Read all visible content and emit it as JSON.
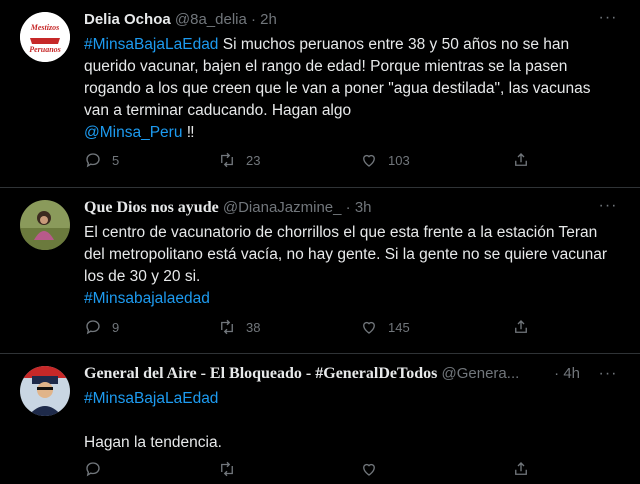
{
  "tweets": [
    {
      "name": "Delia Ochoa",
      "handle": "@8a_delia",
      "dot": "·",
      "time": "2h",
      "more": "···",
      "hashtag": "#MinsaBajaLaEdad",
      "text": " Si muchos peruanos entre 38 y 50 años no se han querido vacunar, bajen el rango de edad! Porque mientras se la pasen rogando a los que creen que le van a poner \"agua destilada\", las vacunas van a terminar caducando.  Hagan algo",
      "mention": "@Minsa_Peru",
      "after_mention": " ‼",
      "replies": "5",
      "retweets": "23",
      "likes": "103",
      "avatar_text": "Mestizos Peruanos"
    },
    {
      "name": "Que Dios nos ayude",
      "handle": "@DianaJazmine_",
      "dot": "·",
      "time": "3h",
      "more": "···",
      "text": "El centro de vacunatorio de chorrillos el que esta frente a la estación Teran del metropolitano está vacía, no hay gente. Si la gente no se quiere vacunar los de 30 y 20 si.",
      "hashtag": "#Minsabajalaedad",
      "replies": "9",
      "retweets": "38",
      "likes": "145"
    },
    {
      "name": "General del Aire - El Bloqueado - #GeneralDeTodos",
      "handle": "@Genera...",
      "dot": "·",
      "time": "4h",
      "hashtag": "#MinsaBajaLaEdad",
      "text": "Hagan la tendencia."
    }
  ],
  "icons": [
    "reply-icon",
    "retweet-icon",
    "like-icon",
    "share-icon",
    "more-icon"
  ]
}
